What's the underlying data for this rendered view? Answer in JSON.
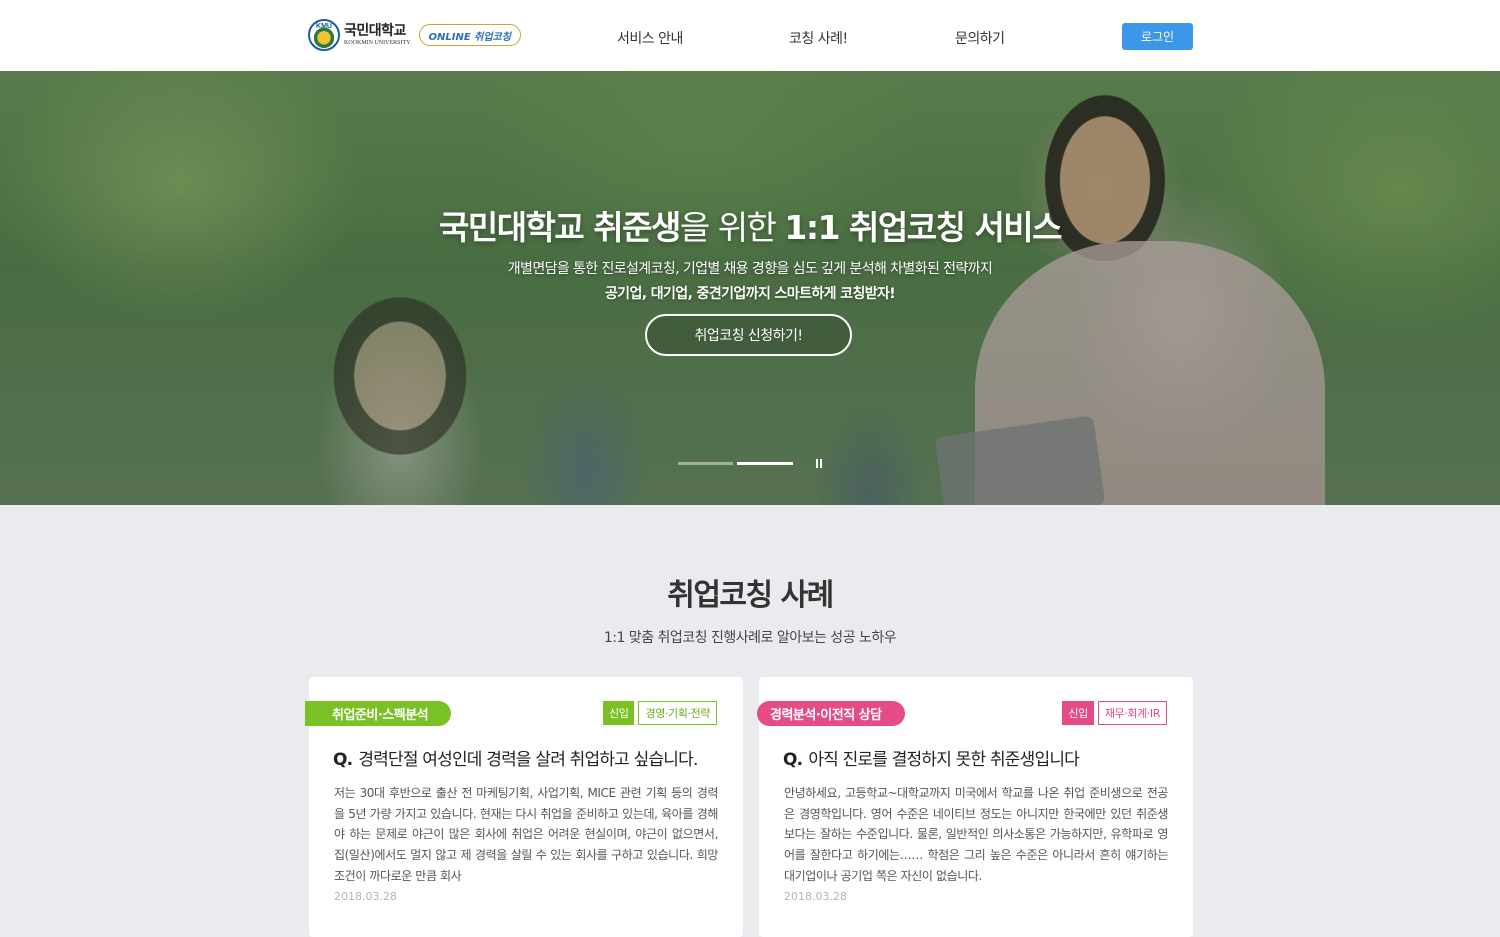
{
  "header": {
    "logo_emblem": "KMU",
    "logo_name": "국민대학교",
    "logo_eng": "KOOKMIN UNIVERSITY",
    "logo_badge": "ONLINE 취업코칭",
    "nav": [
      "서비스 안내",
      "코칭 사례!",
      "문의하기"
    ],
    "login_label": "로그인",
    "accent": "#3d97e8"
  },
  "hero": {
    "title_a": "국민대학교 취준생",
    "title_b": "을 위한 ",
    "title_c": "1:1 취업코칭 서비스",
    "subtitle": "개별면담을 통한 진로설계코칭, 기업별 채용 경향을 심도 깊게 분석해 차별화된 전략까지",
    "subtitle2": "공기업, 대기업, 중견기업까지 스마트하게 코칭받자!",
    "cta_label": "취업코칭 신청하기!",
    "slide_count": 2,
    "active_slide": 2
  },
  "section": {
    "title": "취업코칭 사례",
    "subtitle": "1:1 맞춤 취업코칭 진행사례로 알아보는 성공 노하우"
  },
  "cards": [
    {
      "category": "취업준비·스펙분석",
      "tag1": "신입",
      "tag2": "경영·기획·전략",
      "q": "Q.",
      "question": "경력단절 여성인데 경력을 살려 취업하고 싶습니다.",
      "body": "저는 30대 후반으로 출산 전 마케팅기획, 사업기획, MICE 관련 기획 등의 경력을 5년 가량 가지고 있습니다. 현재는 다시 취업을 준비하고 있는데, 육아를 경해야 하는 문제로 야근이 많은 회사에 취업은 어려운 현실이며, 야근이 없으면서, 집(일산)에서도 멀지 않고 제 경력을 살릴 수 있는 회사를 구하고 있습니다. 희망 조건이 까다로운 만큼 회사",
      "date": "2018.03.28",
      "color": "#7ac126"
    },
    {
      "category": "경력분석·이전직 상담",
      "tag1": "신입",
      "tag2": "재무·회계·IR",
      "q": "Q.",
      "question": "아직 진로를 결정하지 못한 취준생입니다",
      "body": "안녕하세요, 고등학교~대학교까지 미국에서 학교를 나온 취업 준비생으로 전공은 경영학입니다. 영어 수준은 네이티브 정도는 아니지만 한국에만 있던 취준생보다는 잘하는 수준입니다. 물론, 일반적인 의사소통은 가능하지만, 유학파로 영어를 잘한다고 하기에는…… 학점은 그리 높은 수준은 아니라서 흔히 얘기하는 대기업이나 공기업 쪽은 자신이 없습니다.",
      "date": "2018.03.28",
      "color": "#e54b86"
    }
  ]
}
